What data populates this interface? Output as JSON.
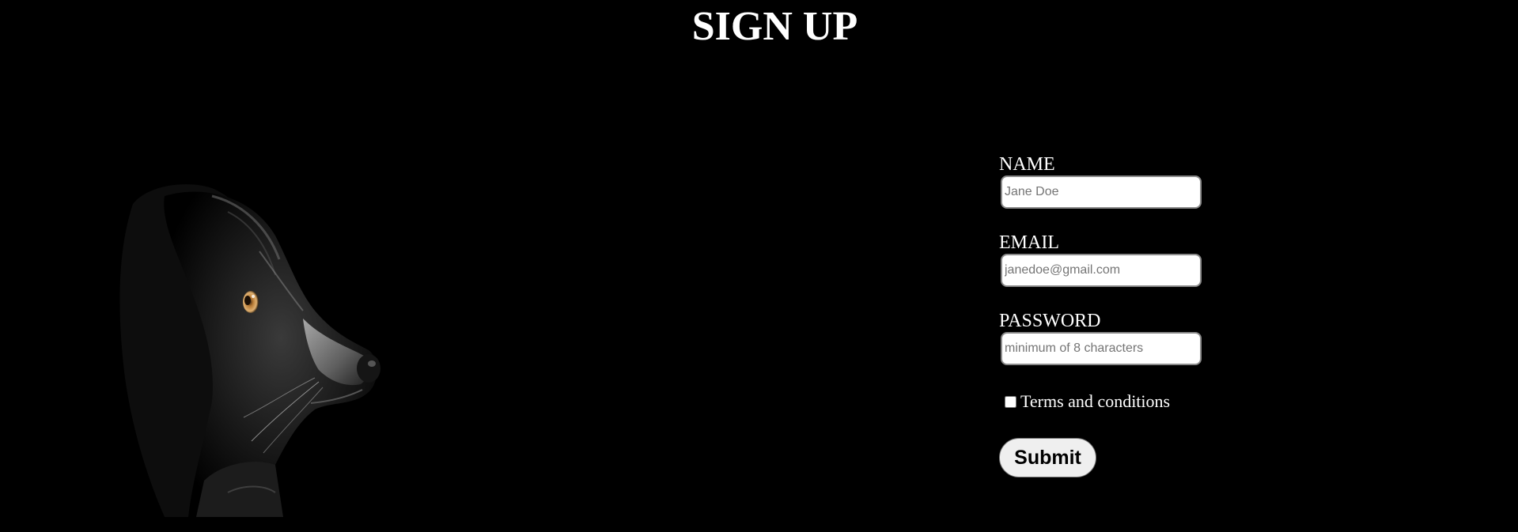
{
  "page": {
    "title": "SIGN UP"
  },
  "hero_image": {
    "subject": "dog-profile-photo"
  },
  "form": {
    "name": {
      "label": "NAME",
      "placeholder": "Jane Doe",
      "value": ""
    },
    "email": {
      "label": "EMAIL",
      "placeholder": "janedoe@gmail.com",
      "value": ""
    },
    "password": {
      "label": "PASSWORD",
      "placeholder": "minimum of 8 characters",
      "value": ""
    },
    "terms": {
      "label": "Terms and conditions",
      "checked": false
    },
    "submit_label": "Submit"
  },
  "colors": {
    "background": "#000000",
    "text": "#ffffff",
    "button_bg": "#efefef"
  }
}
